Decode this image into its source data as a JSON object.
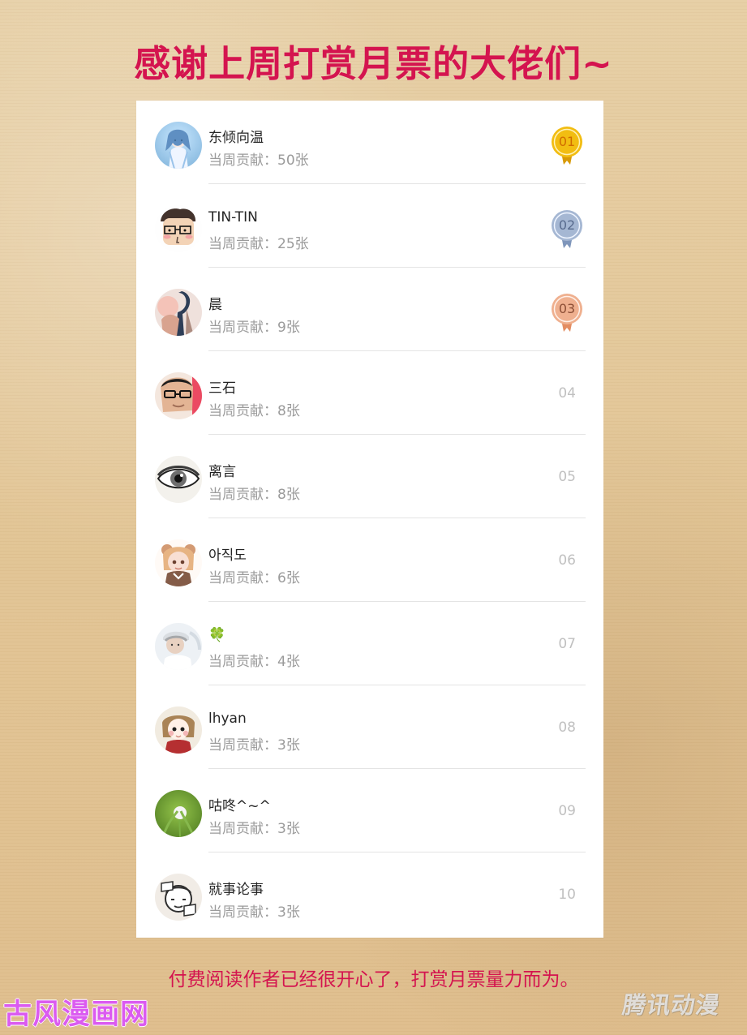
{
  "page": {
    "title": "感谢上周打赏月票的大佬们~",
    "footer_note": "付费阅读作者已经很开心了，打赏月票量力而为。",
    "bottom_left_logo": "古风漫画网",
    "bottom_right_logo": "腾讯动漫"
  },
  "leaderboard": [
    {
      "name": "东倾向温",
      "contribution": "当周贡献：50张",
      "rank": "01",
      "rank_style": "gold-medal",
      "avatar_icon": "anime-girl-avatar-icon"
    },
    {
      "name": "TIN-TIN",
      "contribution": "当周贡献：25张",
      "rank": "02",
      "rank_style": "silver-medal",
      "avatar_icon": "cartoon-face-avatar-icon"
    },
    {
      "name": "晨",
      "contribution": "当周贡献：9张",
      "rank": "03",
      "rank_style": "bronze-medal",
      "avatar_icon": "fashion-photo-avatar-icon"
    },
    {
      "name": "三石",
      "contribution": "当周贡献：8张",
      "rank": "04",
      "rank_style": "plain",
      "avatar_icon": "man-glasses-avatar-icon"
    },
    {
      "name": "离言",
      "contribution": "当周贡献：8张",
      "rank": "05",
      "rank_style": "plain",
      "avatar_icon": "eye-avatar-icon"
    },
    {
      "name": "아직도",
      "contribution": "当周贡献：6张",
      "rank": "06",
      "rank_style": "plain",
      "avatar_icon": "anime-bear-girl-avatar-icon"
    },
    {
      "name": "🍀",
      "contribution": "当周贡献：4张",
      "rank": "07",
      "rank_style": "plain",
      "avatar_icon": "person-cap-avatar-icon"
    },
    {
      "name": "lhyan",
      "contribution": "当周贡献：3张",
      "rank": "08",
      "rank_style": "plain",
      "avatar_icon": "child-face-avatar-icon"
    },
    {
      "name": "咕咚^~^",
      "contribution": "当周贡献：3张",
      "rank": "09",
      "rank_style": "plain",
      "avatar_icon": "dandelion-avatar-icon"
    },
    {
      "name": "就事论事",
      "contribution": "当周贡献：3张",
      "rank": "10",
      "rank_style": "plain",
      "avatar_icon": "comic-sketch-avatar-icon"
    }
  ],
  "colors": {
    "accent": "#d4144f",
    "name_text": "#242424",
    "contribution_text": "#9b9b9b",
    "rank_text": "#c0c0c0",
    "gold": "#f2bd12",
    "silver": "#a5b7d3",
    "bronze": "#efb08f",
    "logo_left": "#db5bf0"
  }
}
